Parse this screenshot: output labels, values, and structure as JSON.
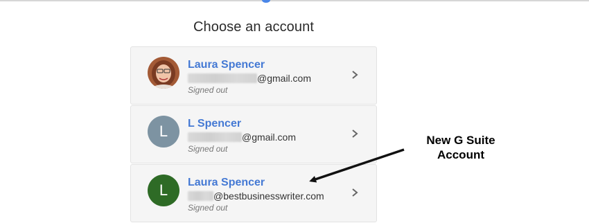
{
  "title": "Choose an account",
  "accounts": [
    {
      "name": "Laura Spencer",
      "email_suffix": "@gmail.com",
      "status": "Signed out",
      "avatar_type": "photo",
      "avatar_color": "#b5643a"
    },
    {
      "name": "L Spencer",
      "email_suffix": "@gmail.com",
      "status": "Signed out",
      "avatar_letter": "L",
      "avatar_color": "#7d93a2"
    },
    {
      "name": "Laura Spencer",
      "email_suffix": "@bestbusinesswriter.com",
      "status": "Signed out",
      "avatar_letter": "L",
      "avatar_color": "#2e6b26"
    }
  ],
  "annotation": {
    "line1": "New G Suite",
    "line2": "Account"
  },
  "colors": {
    "name": "#4479d4",
    "card_bg": "#f5f5f5"
  },
  "icons": {
    "chevron": "chevron-right-icon"
  }
}
